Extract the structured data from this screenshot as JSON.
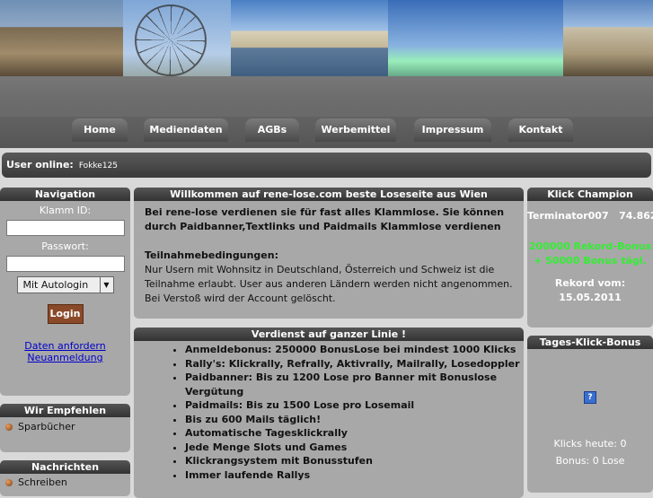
{
  "nav": [
    "Home",
    "Mediendaten",
    "AGBs",
    "Werbemittel",
    "Impressum",
    "Kontakt"
  ],
  "user_online": {
    "label": "User online:",
    "name": "Fokke125"
  },
  "left": {
    "navigation_title": "Navigation",
    "klamm_label": "Klamm ID:",
    "pass_label": "Passwort:",
    "select_value": "Mit Autologin",
    "login_label": "Login",
    "link1": "Daten anfordern",
    "link2": "Neuanmeldung",
    "empfehlen_title": "Wir Empfehlen",
    "empfehlen_item": "Sparbücher",
    "nachrichten_title": "Nachrichten",
    "nachrichten_item": "Schreiben"
  },
  "welcome": {
    "title": "Willkommen auf rene-lose.com beste Loseseite aus Wien",
    "intro": "Bei rene-lose verdienen sie für fast alles Klammlose. Sie können durch Paidbanner,Textlinks und Paidmails Klammlose verdienen",
    "cond_title": "Teilnahmebedingungen:",
    "cond_text": "Nur Usern mit Wohnsitz in Deutschland, Österreich und Schweiz ist die Teilnahme erlaubt. User aus anderen Ländern werden nicht angenommen. Bei Verstoß wird der Account gelöscht."
  },
  "earn": {
    "title": "Verdienst auf ganzer Linie !",
    "items": [
      "Anmeldebonus: 250000 BonusLose bei mindest 1000 Klicks",
      "Rally's: Klickrally, Refrally, Aktivrally, Mailrally, Losedoppler",
      "Paidbanner: Bis zu 1200 Lose pro Banner mit Bonuslose Vergütung",
      "Paidmails: Bis zu 1500 Lose pro Losemail",
      "Bis zu 600 Mails täglich!",
      "Automatische Tagesklickrally",
      "Jede Menge Slots und Games",
      "Klickrangsystem mit Bonusstufen",
      "Immer laufende Rallys"
    ]
  },
  "champion": {
    "title": "Klick Champion",
    "name": "Terminator007",
    "score": "74.862",
    "bonus1": "200000 Rekord-Bonus",
    "bonus2": "+ 50000 Bonus tägl.",
    "record_label": "Rekord vom:",
    "record_date": "15.05.2011"
  },
  "daily": {
    "title": "Tages-Klick-Bonus",
    "icon": "?",
    "clicks": "Klicks heute: 0",
    "bonus": "Bonus: 0 Lose"
  },
  "colors": {
    "accent": "#8a4a2a",
    "link": "#0000cc",
    "header": "#3a3a3a",
    "green": "#33ee33"
  }
}
